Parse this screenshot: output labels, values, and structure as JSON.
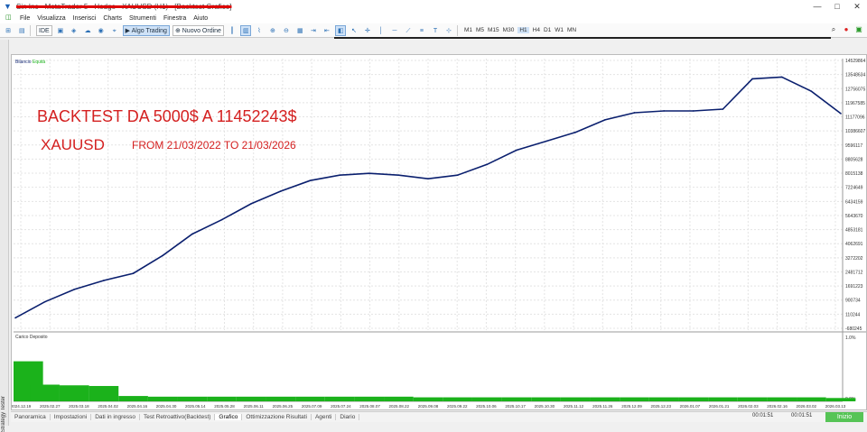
{
  "window": {
    "title": "Sin Inc - MetaTrader 5 - Hedge - XAUUSD (H1) - [Backtest Grafico]",
    "controls": [
      "—",
      "□",
      "✕"
    ]
  },
  "menu": {
    "items": [
      "File",
      "Visualizza",
      "Inserisci",
      "Charts",
      "Strumenti",
      "Finestra",
      "Aiuto"
    ]
  },
  "toolbar": {
    "ide_label": "IDE",
    "algo_trading_label": "Algo Trading",
    "new_order_label": "Nuovo Ordine",
    "timeframes": [
      "M1",
      "M5",
      "M15",
      "M30",
      "H1",
      "H4",
      "D1",
      "W1",
      "MN"
    ],
    "selected_timeframe": "H1"
  },
  "chart": {
    "legend_balance": "Bilancio",
    "legend_equity": "Equità",
    "overlay_line1": "BACKTEST DA 5000$ A 11452243$",
    "overlay_line2_symbol": "XAUUSD",
    "overlay_line2_range": "FROM 21/03/2022 TO 21/03/2026",
    "y_ticks": [
      "14529864",
      "13548634",
      "12756075",
      "11967585",
      "11177096",
      "10386607",
      "9596117",
      "8805628",
      "8015138",
      "7224649",
      "6434159",
      "5643670",
      "4853181",
      "4062691",
      "3272202",
      "2481712",
      "1691223",
      "900734",
      "110244",
      "-680245"
    ],
    "deposit_label": "Carico Deposito",
    "deposit_ticks": [
      "1.0%",
      "0.0%"
    ],
    "x_ticks": [
      "2024.12.19",
      "2025.02.27",
      "2025.03.18",
      "2025.04.02",
      "2025.04.16",
      "2025.04.30",
      "2025.05.14",
      "2025.05.28",
      "2025.06.11",
      "2025.06.25",
      "2025.07.09",
      "2025.07.24",
      "2025.08.07",
      "2025.08.22",
      "2025.09.08",
      "2025.09.22",
      "2025.10.06",
      "2025.10.17",
      "2025.10.30",
      "2025.11.12",
      "2025.11.26",
      "2025.12.09",
      "2025.12.23",
      "2026.01.07",
      "2026.01.21",
      "2026.02.03",
      "2026.02.16",
      "2026.03.02",
      "2026.03.13"
    ]
  },
  "chart_data": {
    "type": "line",
    "title": "",
    "series": [
      {
        "name": "Bilancio",
        "x": [
          "2024.12.19",
          "2025.02.27",
          "2025.03.18",
          "2025.04.02",
          "2025.04.16",
          "2025.04.30",
          "2025.05.14",
          "2025.05.28",
          "2025.06.11",
          "2025.06.25",
          "2025.07.09",
          "2025.07.24",
          "2025.08.07",
          "2025.08.22",
          "2025.09.08",
          "2025.09.22",
          "2025.10.06",
          "2025.10.17",
          "2025.10.30",
          "2025.11.12",
          "2025.11.26",
          "2025.12.09",
          "2025.12.23",
          "2026.01.07",
          "2026.01.21",
          "2026.02.03",
          "2026.02.16",
          "2026.03.02",
          "2026.03.13"
        ],
        "values": [
          5000,
          900000,
          1600000,
          2100000,
          2500000,
          3500000,
          4700000,
          5500000,
          6400000,
          7100000,
          7700000,
          8000000,
          8100000,
          8000000,
          7800000,
          8000000,
          8600000,
          9400000,
          9900000,
          10400000,
          11100000,
          11500000,
          11600000,
          11600000,
          11700000,
          13400000,
          13500000,
          12700000,
          11452243
        ]
      }
    ],
    "ylim": [
      -680245,
      14529864
    ],
    "deposit_load": {
      "name": "Carico Deposito",
      "values": [
        0.6,
        0.25,
        0.24,
        0.23,
        0.08,
        0.07,
        0.07,
        0.07,
        0.07,
        0.07,
        0.07,
        0.07,
        0.07,
        0.07,
        0.06,
        0.06,
        0.06,
        0.06,
        0.06,
        0.06,
        0.06,
        0.06,
        0.06,
        0.06,
        0.06,
        0.06,
        0.06,
        0.06,
        0.05
      ],
      "ylim": [
        0,
        1.0
      ]
    },
    "colors": {
      "balance": "#0a1f6e",
      "deposit": "#1bb21b",
      "overlay_text": "#d42020"
    }
  },
  "tabs": {
    "items": [
      "Panoramica",
      "Impostazioni",
      "Dati in ingresso",
      "Test Retroattivo(Backtest)",
      "Grafico",
      "Ottimizzazione Risultati",
      "Agenti",
      "Diario"
    ],
    "active": "Grafico"
  },
  "status": {
    "elapsed": "00:01:51",
    "elapsed_total": "00:01:51",
    "start_label": "Inizio"
  },
  "side": {
    "label": "Strategy Tester"
  }
}
